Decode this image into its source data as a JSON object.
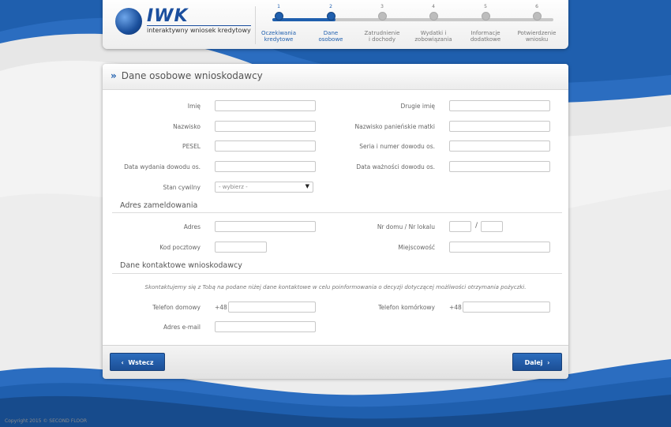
{
  "app": {
    "logo_name": "IWK",
    "logo_tagline": "interaktywny wniosek kredytowy"
  },
  "steps": [
    {
      "num": "1",
      "label1": "Oczekiwania",
      "label2": "kredytowe",
      "active": true
    },
    {
      "num": "2",
      "label1": "Dane",
      "label2": "osobowe",
      "active": true
    },
    {
      "num": "3",
      "label1": "Zatrudnienie",
      "label2": "i dochody",
      "active": false
    },
    {
      "num": "4",
      "label1": "Wydatki i",
      "label2": "zobowiązania",
      "active": false
    },
    {
      "num": "5",
      "label1": "Informacje",
      "label2": "dodatkowe",
      "active": false
    },
    {
      "num": "6",
      "label1": "Potwierdzenie",
      "label2": "wniosku",
      "active": false
    }
  ],
  "form": {
    "title_chevron": "»",
    "title": "Dane osobowe wnioskodawcy",
    "labels": {
      "imie": "Imię",
      "drugie_imie": "Drugie imię",
      "nazwisko": "Nazwisko",
      "nazwisko_panienskie": "Nazwisko panieńskie matki",
      "pesel": "PESEL",
      "seria_dowodu": "Seria i numer dowodu os.",
      "data_wydania": "Data wydania dowodu os.",
      "data_waznosci": "Data ważności dowodu os.",
      "stan_cywilny": "Stan cywilny"
    },
    "stan_cywilny_value": "- wybierz -",
    "address_section": "Adres zameldowania",
    "address_labels": {
      "adres": "Adres",
      "nr_domu": "Nr domu / Nr lokalu",
      "slash": "/",
      "kod_pocztowy": "Kod pocztowy",
      "miejscowosc": "Miejscowość"
    },
    "contact_section": "Dane kontaktowe wnioskodawcy",
    "contact_info": "Skontaktujemy się z Tobą na podane niżej dane kontaktowe w celu poinformowania o decyzji dotyczącej możliwości otrzymania pożyczki.",
    "contact_labels": {
      "telefon_domowy": "Telefon domowy",
      "telefon_komorkowy": "Telefon komórkowy",
      "email": "Adres e-mail",
      "prefix": "+48"
    }
  },
  "buttons": {
    "back": "Wstecz",
    "back_icon": "‹",
    "next": "Dalej",
    "next_icon": "›"
  },
  "footer": {
    "copyright": "Copyright 2015 © SECOND FLOOR"
  },
  "colors": {
    "brand": "#1f5fae",
    "background": "#1f5fae"
  }
}
